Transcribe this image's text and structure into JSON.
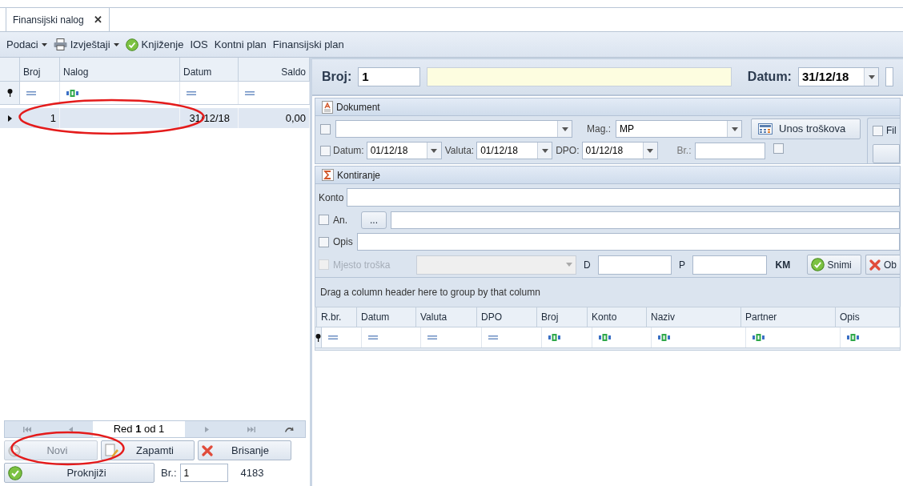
{
  "tabs": [
    {
      "label": "Finansijski nalog",
      "selected": true,
      "close": "✕"
    }
  ],
  "toolbar": [
    {
      "label": "Podaci",
      "kind": "menu"
    },
    {
      "label": "Izvještaji",
      "kind": "print-menu"
    },
    {
      "label": "Knjiženje",
      "kind": "check"
    },
    {
      "label": "IOS",
      "kind": "plain"
    },
    {
      "label": "Kontni plan",
      "kind": "plain"
    },
    {
      "label": "Finansijski plan",
      "kind": "plain"
    }
  ],
  "list": {
    "columns": [
      {
        "label": "Broj",
        "kind": "number"
      },
      {
        "label": "Nalog",
        "kind": "text"
      },
      {
        "label": "Datum",
        "kind": "number"
      },
      {
        "label": "Saldo",
        "kind": "number"
      }
    ],
    "rows": [
      {
        "selected": true,
        "cells": [
          "1",
          "",
          "31/12/18",
          "0,00"
        ]
      }
    ]
  },
  "navigator": {
    "status": "Red **1** od 1"
  },
  "actions": [
    {
      "label": "Novi",
      "kind": "new",
      "disabled": true
    },
    {
      "label": "Zapamti",
      "kind": "save",
      "disabled": false
    },
    {
      "label": "Brisanje",
      "kind": "delete",
      "disabled": false
    }
  ],
  "post": {
    "label": "Proknjiži",
    "br_label": "Br.:",
    "br_value": "1",
    "count": "4183"
  },
  "header": {
    "broj_label": "Broj:",
    "broj_value": "1",
    "datum_label": "Datum:",
    "datum_value": "31/12/18"
  },
  "dokument": {
    "title": "Dokument",
    "checked": false,
    "mag_label": "Mag.:",
    "mag_value": "MP",
    "costs_button": "Unos troškova",
    "filter_checked": false,
    "filter_label": "Fil",
    "dates": [
      {
        "label": "Datum:",
        "value": "01/12/18",
        "checked": false
      },
      {
        "label": "Valuta:",
        "value": "01/12/18"
      },
      {
        "label": "DPO:",
        "value": "01/12/18"
      }
    ],
    "br_label": "Br.:",
    "br_checked": false
  },
  "kontiranje": {
    "title": "Kontiranje",
    "konto_label": "Konto",
    "an_label": "An.",
    "an_checked": false,
    "an_button": "...",
    "opis_label": "Opis",
    "opis_checked": false,
    "mjesto_label": "Mjesto troška",
    "mjesto_checked": false,
    "mjesto_disabled": true,
    "d_label": "D",
    "p_label": "P",
    "currency": "KM",
    "save": "Snimi",
    "delete": "Ob"
  },
  "grid": {
    "group_hint": "Drag a column header here to group by that column",
    "columns": [
      {
        "label": "R.br.",
        "kind": "number"
      },
      {
        "label": "Datum",
        "kind": "number"
      },
      {
        "label": "Valuta",
        "kind": "number"
      },
      {
        "label": "DPO",
        "kind": "number"
      },
      {
        "label": "Broj",
        "kind": "text"
      },
      {
        "label": "Konto",
        "kind": "text"
      },
      {
        "label": "Naziv",
        "kind": "text"
      },
      {
        "label": "Partner",
        "kind": "text"
      },
      {
        "label": "Opis",
        "kind": "text"
      }
    ]
  }
}
